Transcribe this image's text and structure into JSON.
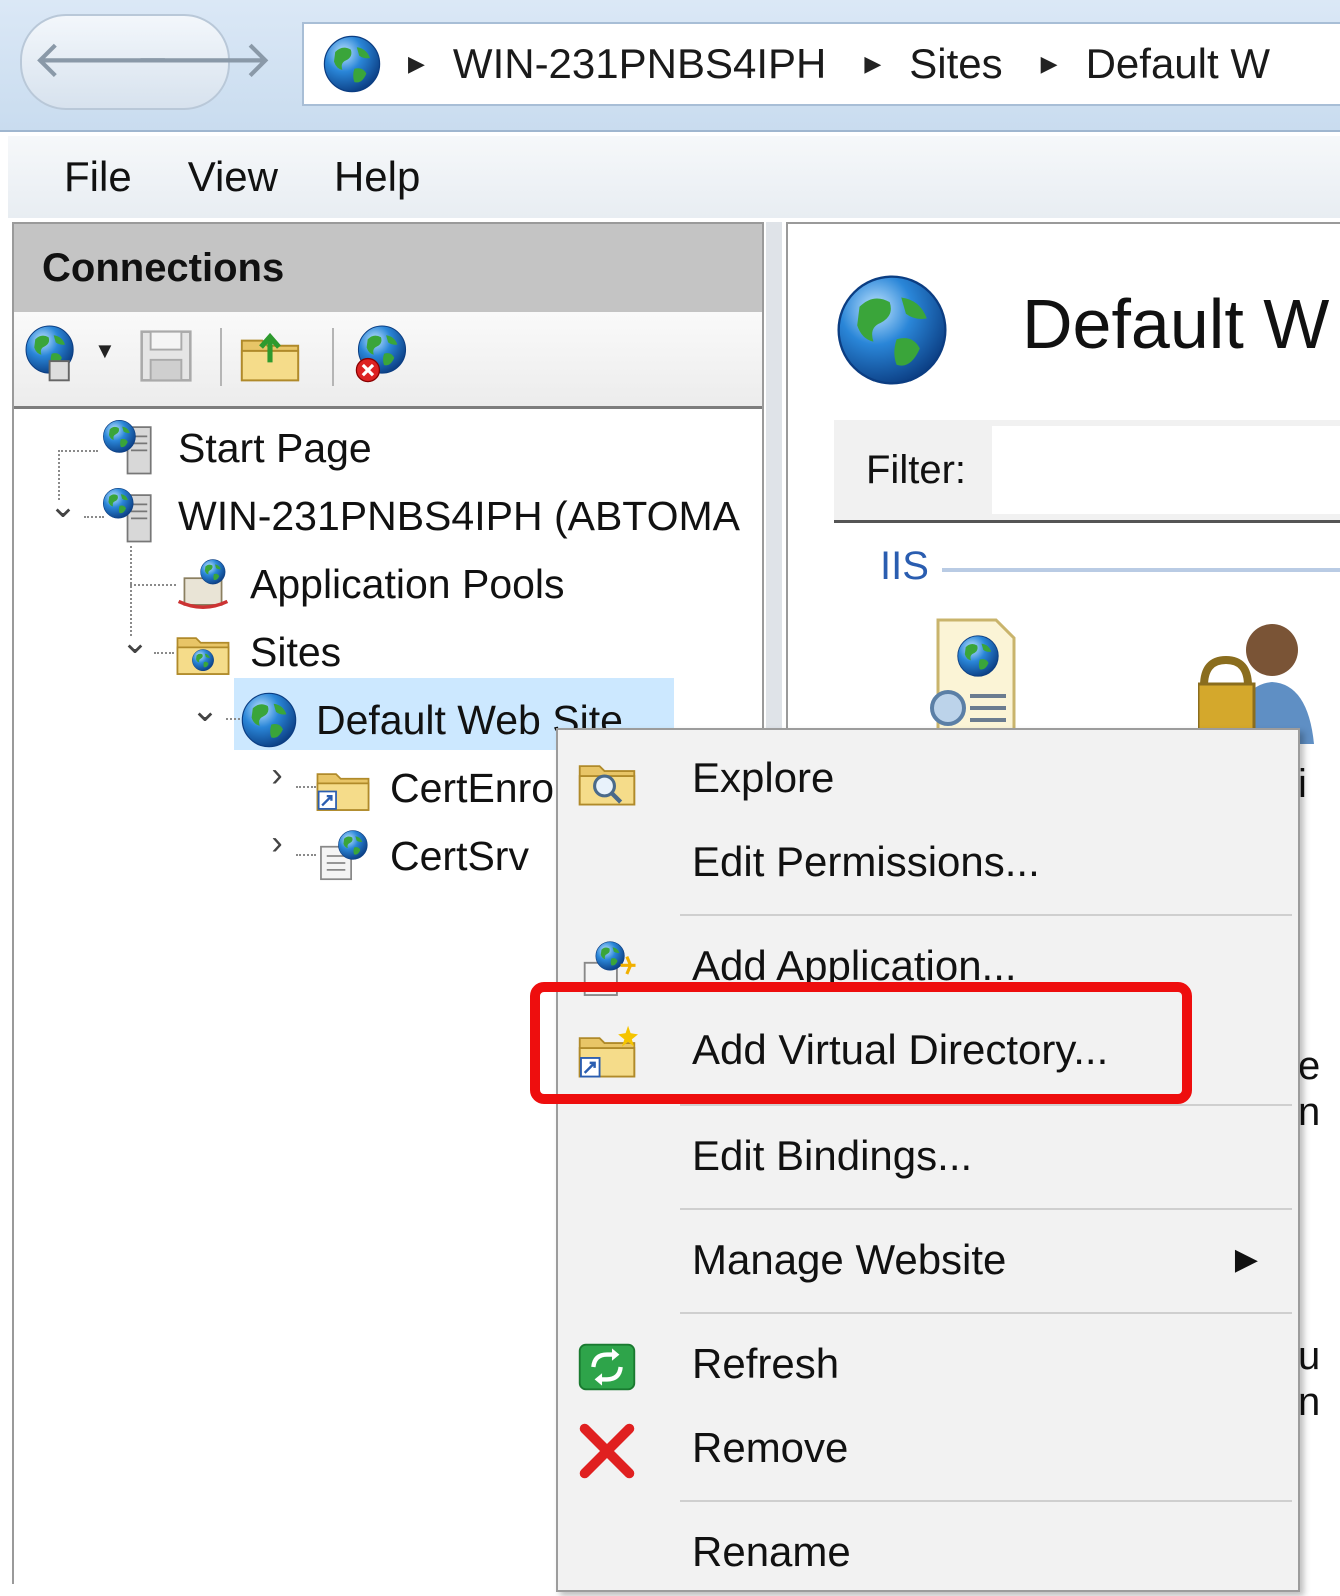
{
  "address_bar": {
    "back_glyph": "🡐",
    "forward_glyph": "🡒",
    "breadcrumbs": [
      "WIN-231PNBS4IPH",
      "Sites",
      "Default W"
    ],
    "separator_glyph": "▶"
  },
  "menubar": {
    "items": [
      "File",
      "View",
      "Help"
    ]
  },
  "connections": {
    "title": "Connections",
    "tree": {
      "start_page": "Start Page",
      "server": "WIN-231PNBS4IPH (ABTOMA",
      "app_pools": "Application Pools",
      "sites": "Sites",
      "default_site": "Default Web Site",
      "certenroll": "CertEnro",
      "certsrv": "CertSrv"
    },
    "expander_open": "⌄",
    "expander_closed": "›"
  },
  "content": {
    "title": "Default W",
    "filter_label": "Filter:",
    "group_label": "IIS",
    "peek_text": [
      "i",
      "e",
      "n",
      "u",
      "n"
    ]
  },
  "context_menu": {
    "items": [
      {
        "label": "Explore",
        "icon": "folder-search-icon"
      },
      {
        "label": "Edit Permissions...",
        "icon": ""
      },
      {
        "label": "Add Application...",
        "icon": "add-application-icon"
      },
      {
        "label": "Add Virtual Directory...",
        "icon": "virtual-directory-icon"
      },
      {
        "label": "Edit Bindings...",
        "icon": ""
      },
      {
        "label": "Manage Website",
        "icon": "",
        "submenu": true
      },
      {
        "label": "Refresh",
        "icon": "refresh-icon"
      },
      {
        "label": "Remove",
        "icon": "remove-icon"
      },
      {
        "label": "Rename",
        "icon": ""
      }
    ],
    "submenu_glyph": "▶"
  },
  "colors": {
    "highlight": "#ee0e0e",
    "selection": "#cce8ff",
    "accent_blue": "#2a5db0"
  }
}
